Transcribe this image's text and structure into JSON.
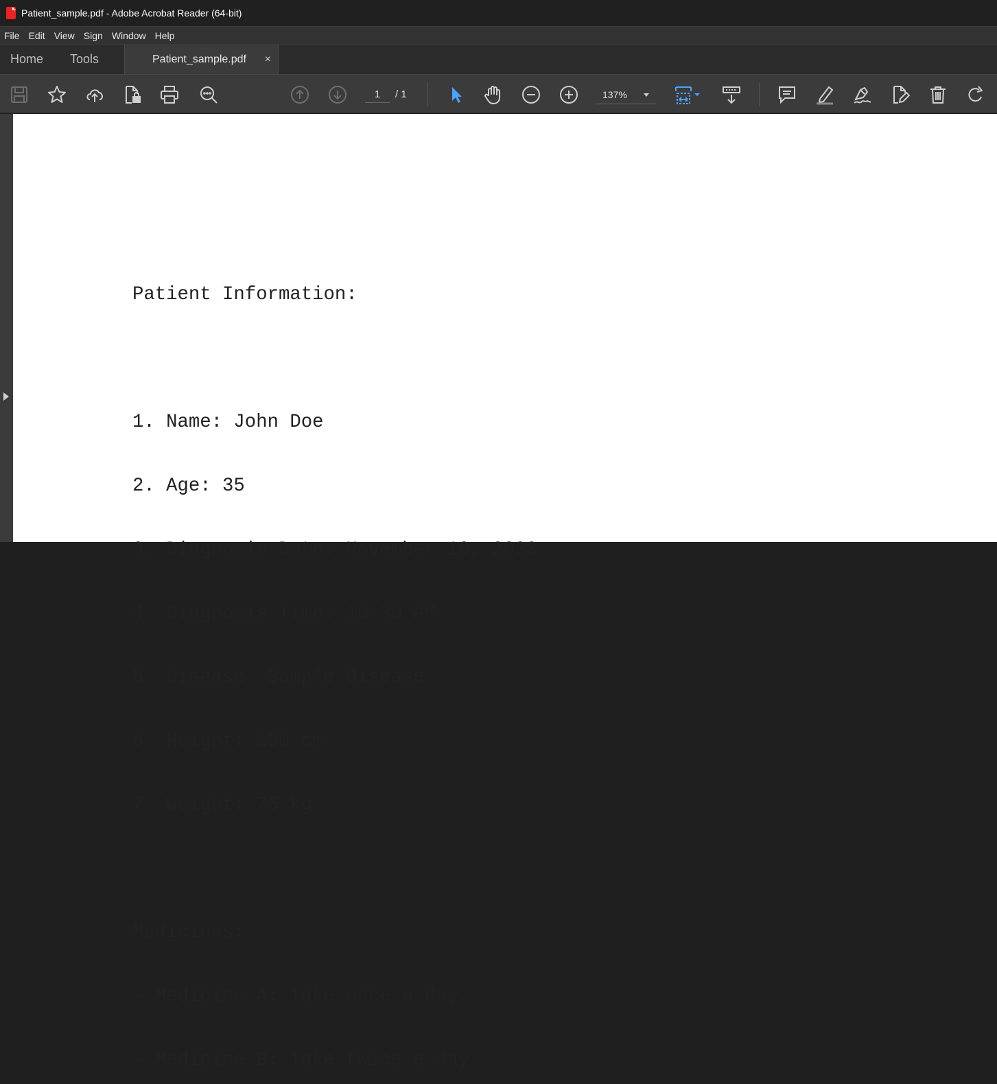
{
  "window": {
    "title": "Patient_sample.pdf - Adobe Acrobat Reader (64-bit)"
  },
  "menu": [
    "File",
    "Edit",
    "View",
    "Sign",
    "Window",
    "Help"
  ],
  "tabs": {
    "home": "Home",
    "tools": "Tools",
    "document": "Patient_sample.pdf",
    "close": "×"
  },
  "toolbar": {
    "page_current": "1",
    "page_total": "/ 1",
    "zoom": "137%"
  },
  "document": {
    "heading": "Patient Information:",
    "items": [
      "1. Name: John Doe",
      "2. Age: 35",
      "3. Diagnosis Date: November 10, 2023",
      "4. Diagnosis Time: 10:30 AM",
      "5. Disease: Sample Disease",
      "6. Height: 180 cm",
      "7. Weight: 75 kg"
    ],
    "medicines_heading": "Medicines:",
    "medicines": [
      "- Medicine A: Take once a day.",
      "- Medicine B: Take twice a day."
    ]
  },
  "colors": {
    "accent": "#4aa3ff",
    "toolbar_bg": "#3b3b3b",
    "title_bg": "#202020"
  }
}
